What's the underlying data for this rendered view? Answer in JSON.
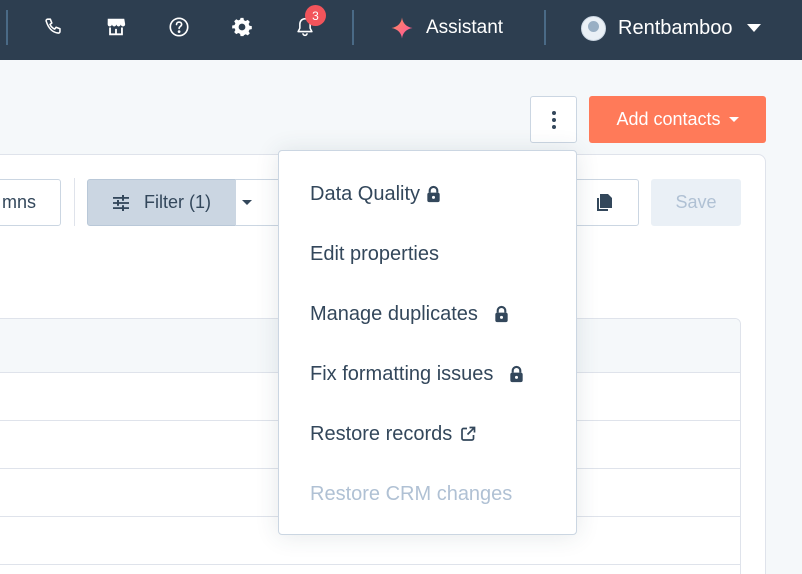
{
  "topnav": {
    "notification_count": "3",
    "assistant_label": "Assistant",
    "account_name": "Rentbamboo"
  },
  "header": {
    "add_contacts_label": "Add contacts"
  },
  "toolbar": {
    "columns_label": "mns",
    "filter_label": "Filter (1)",
    "save_label": "Save"
  },
  "menu": {
    "items": [
      {
        "label": "Data Quality",
        "locked": true,
        "disabled": false
      },
      {
        "label": "Edit properties",
        "locked": false,
        "disabled": false
      },
      {
        "label": "Manage duplicates",
        "locked": true,
        "disabled": false
      },
      {
        "label": "Fix formatting issues",
        "locked": true,
        "disabled": false
      },
      {
        "label": "Restore records",
        "locked": false,
        "external": true,
        "disabled": false
      },
      {
        "label": "Restore CRM changes",
        "locked": false,
        "disabled": true
      }
    ]
  },
  "colors": {
    "nav_bg": "#2d3e50",
    "accent": "#ff7a59",
    "badge": "#f2545b",
    "assistant_star": "#ff5c8a"
  }
}
